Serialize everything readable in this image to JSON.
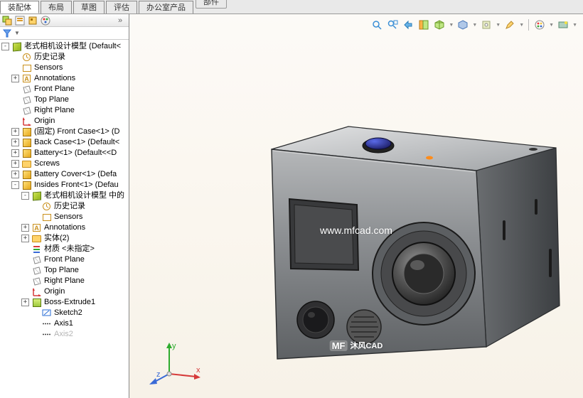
{
  "top_label": "部件",
  "tabs": [
    "装配体",
    "布局",
    "草图",
    "评估",
    "办公室产品"
  ],
  "active_tab": 0,
  "filter_label": "▼",
  "tree": {
    "root": "老式相机设计模型 (Default<",
    "items": [
      {
        "label": "历史记录",
        "icon": "hist"
      },
      {
        "label": "Sensors",
        "icon": "sensor"
      },
      {
        "label": "Annotations",
        "icon": "ann",
        "expand": "+"
      },
      {
        "label": "Front Plane",
        "icon": "plane"
      },
      {
        "label": "Top Plane",
        "icon": "plane"
      },
      {
        "label": "Right Plane",
        "icon": "plane"
      },
      {
        "label": "Origin",
        "icon": "origin"
      },
      {
        "label": "(固定) Front Case<1> (D",
        "icon": "part",
        "expand": "+"
      },
      {
        "label": "Back Case<1> (Default<",
        "icon": "part",
        "expand": "+"
      },
      {
        "label": "Battery<1> (Default<<D",
        "icon": "part",
        "expand": "+"
      },
      {
        "label": "Screws",
        "icon": "folder",
        "expand": "+"
      },
      {
        "label": "Battery Cover<1> (Defa",
        "icon": "part",
        "expand": "+"
      },
      {
        "label": "Insides Front<1> (Defau",
        "icon": "part",
        "expand": "-",
        "children": [
          {
            "label": "老式相机设计模型 中的",
            "icon": "cube",
            "expand": "-",
            "indent": 1
          },
          {
            "label": "历史记录",
            "icon": "hist",
            "indent": 2
          },
          {
            "label": "Sensors",
            "icon": "sensor",
            "indent": 2
          },
          {
            "label": "Annotations",
            "icon": "ann",
            "expand": "+",
            "indent": 1
          },
          {
            "label": "实体(2)",
            "icon": "folder",
            "expand": "+",
            "indent": 1
          },
          {
            "label": "材质 <未指定>",
            "icon": "mat",
            "indent": 1
          },
          {
            "label": "Front Plane",
            "icon": "plane",
            "indent": 1
          },
          {
            "label": "Top Plane",
            "icon": "plane",
            "indent": 1
          },
          {
            "label": "Right Plane",
            "icon": "plane",
            "indent": 1
          },
          {
            "label": "Origin",
            "icon": "origin",
            "indent": 1
          },
          {
            "label": "Boss-Extrude1",
            "icon": "ext",
            "expand": "+",
            "indent": 1
          },
          {
            "label": "Sketch2",
            "icon": "sketch",
            "indent": 2
          },
          {
            "label": "Axis1",
            "icon": "axis",
            "indent": 2
          },
          {
            "label": "Axis2",
            "icon": "axis",
            "indent": 2,
            "cut": true
          }
        ]
      }
    ]
  },
  "watermark_url": "www.mfcad.com",
  "watermark_brand": "沐风CAD",
  "watermark_badge": "MF",
  "triad_labels": {
    "x": "x",
    "y": "y",
    "z": "z"
  },
  "view_toolbar_icons": [
    "zoom-fit",
    "zoom-area",
    "rotate",
    "section",
    "display-style",
    "view-orientation",
    "appearance",
    "scene",
    "render",
    "edit-appearance"
  ]
}
